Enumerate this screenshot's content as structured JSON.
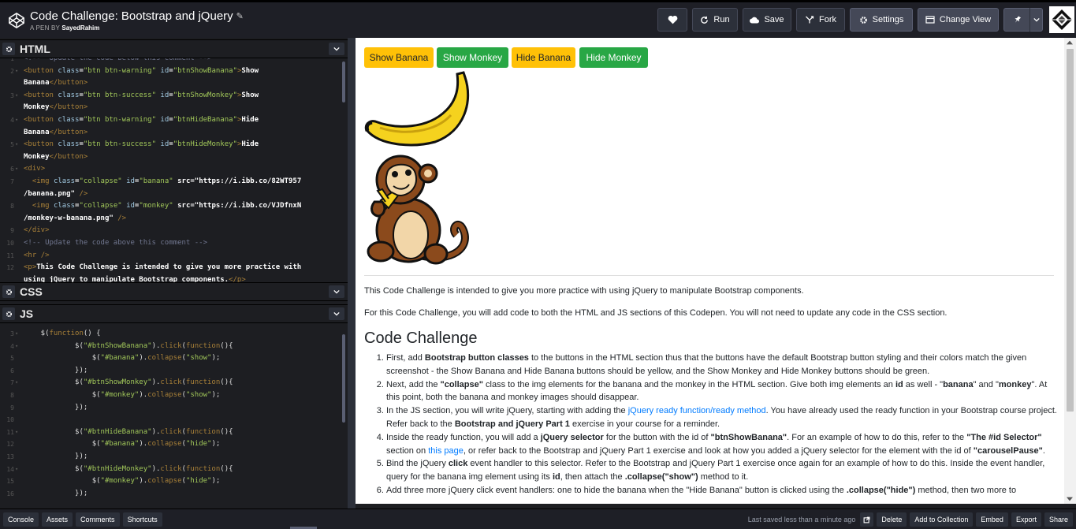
{
  "header": {
    "title": "Code Challenge: Bootstrap and jQuery",
    "byline_prefix": "A PEN BY",
    "author": "SayedRahim",
    "buttons": {
      "run": "Run",
      "save": "Save",
      "fork": "Fork",
      "settings": "Settings",
      "change_view": "Change View"
    }
  },
  "editors": {
    "html": {
      "title": "HTML",
      "lines": [
        {
          "n": "",
          "t": ""
        },
        {
          "n": "2",
          "t": ""
        },
        {
          "n": "",
          "t": ""
        },
        {
          "n": "3",
          "t": ""
        },
        {
          "n": "",
          "t": ""
        },
        {
          "n": "4",
          "t": ""
        },
        {
          "n": "",
          "t": ""
        },
        {
          "n": "5",
          "t": ""
        },
        {
          "n": "",
          "t": ""
        },
        {
          "n": "6",
          "t": ""
        },
        {
          "n": "7",
          "t": ""
        },
        {
          "n": "",
          "t": ""
        },
        {
          "n": "8",
          "t": ""
        },
        {
          "n": "",
          "t": ""
        },
        {
          "n": "9",
          "t": ""
        },
        {
          "n": "10",
          "t": ""
        },
        {
          "n": "11",
          "t": ""
        },
        {
          "n": "12",
          "t": ""
        },
        {
          "n": "",
          "t": ""
        }
      ],
      "code_lines": [
        "<!--  Update the code below this comment -->",
        "<button class=\"btn btn-warning\" id=\"btnShowBanana\">Show",
        "Banana</button>",
        "<button class=\"btn btn-success\" id=\"btnShowMonkey\">Show",
        "Monkey</button>",
        "<button class=\"btn btn-warning\" id=\"btnHideBanana\">Hide",
        "Banana</button>",
        "<button class=\"btn btn-success\" id=\"btnHideMonkey\">Hide",
        "Monkey</button>",
        "<div>",
        "  <img class=\"collapse\" id=\"banana\" src=\"https://i.ibb.co/82WT957",
        "/banana.png\" />",
        "  <img class=\"collapse\" id=\"monkey\" src=\"https://i.ibb.co/VJDfnxN",
        "/monkey-w-banana.png\" />",
        "</div>",
        "<!-- Update the code above this comment -->",
        "<hr />",
        "<p>This Code Challenge is intended to give you more practice with",
        "using jQuery to manipulate Bootstrap components.</p>"
      ]
    },
    "css": {
      "title": "CSS"
    },
    "js": {
      "title": "JS",
      "line_numbers": [
        "3",
        "4",
        "5",
        "6",
        "7",
        "8",
        "9",
        "10",
        "11",
        "12",
        "13",
        "14",
        "15",
        "16"
      ],
      "code_lines": [
        "    $(function() {",
        "            $(\"#btnShowBanana\").click(function(){",
        "                $(\"#banana\").collapse(\"show\");",
        "            });",
        "            $(\"#btnShowMonkey\").click(function(){",
        "                $(\"#monkey\").collapse(\"show\");",
        "            });",
        "",
        "            $(\"#btnHideBanana\").click(function(){",
        "                $(\"#banana\").collapse(\"hide\");",
        "            });",
        "            $(\"#btnHideMonkey\").click(function(){",
        "                $(\"#monkey\").collapse(\"hide\");",
        "            });"
      ]
    }
  },
  "preview": {
    "buttons": {
      "show_banana": "Show Banana",
      "show_monkey": "Show Monkey",
      "hide_banana": "Hide Banana",
      "hide_monkey": "Hide Monkey"
    },
    "intro": "This Code Challenge is intended to give you more practice with using jQuery to manipulate Bootstrap components.",
    "intro2": "For this Code Challenge, you will add code to both the HTML and JS sections of this Codepen. You will not need to update any code in the CSS section.",
    "heading": "Code Challenge",
    "steps": [
      {
        "html": "First, add <b>Bootstrap button classes</b> to the buttons in the HTML section thus that the buttons have the default Bootstrap button styling and their colors match the given screenshot - the Show Banana and Hide Banana buttons should be yellow, and the Show Monkey and Hide Monkey buttons should be green."
      },
      {
        "html": "Next, add the <b>\"collapse\"</b> class to the img elements for the banana and the monkey in the HTML section. Give both img elements an <b>id</b> as well - \"<b>banana</b>\" and \"<b>monkey</b>\". At this point, both the banana and monkey images should disappear."
      },
      {
        "html": "In the JS section, you will write jQuery, starting with adding the <a>jQuery ready function/ready method</a>. You have already used the ready function in your Bootstrap course project. Refer back to the <b>Bootstrap and jQuery Part 1</b> exercise in your course for a reminder."
      },
      {
        "html": "Inside the ready function, you will add a <b>jQuery selector</b> for the button with the id of <b>\"btnShowBanana\"</b>. For an example of how to do this, refer to the <b>\"The #id Selector\"</b> section on <a>this page</a>, or refer back to the Bootstrap and jQuery Part 1 exercise and look at how you added a jQuery selector for the element with the id of <b>\"carouselPause\"</b>."
      },
      {
        "html": "Bind the jQuery <b>click</b> event handler to this selector. Refer to the Bootstrap and jQuery Part 1 exercise once again for an example of how to do this. Inside the event handler, query for the banana img element using its <b>id</b>, then attach the <b>.collapse(\"show\")</b> method to it."
      },
      {
        "html": "Add three more jQuery click event handlers: one to hide the banana when the \"Hide Banana\" button is clicked using the <b>.collapse(\"hide\")</b> method, then two more to"
      }
    ]
  },
  "footer": {
    "console": "Console",
    "assets": "Assets",
    "comments": "Comments",
    "shortcuts": "Shortcuts",
    "status": "Last saved less than a minute ago",
    "delete": "Delete",
    "add_to_collection": "Add to Collection",
    "embed": "Embed",
    "export": "Export",
    "share": "Share"
  },
  "colors": {
    "warning": "#ffc107",
    "success": "#28a745",
    "link": "#007bff",
    "chrome": "#1e1f26"
  }
}
